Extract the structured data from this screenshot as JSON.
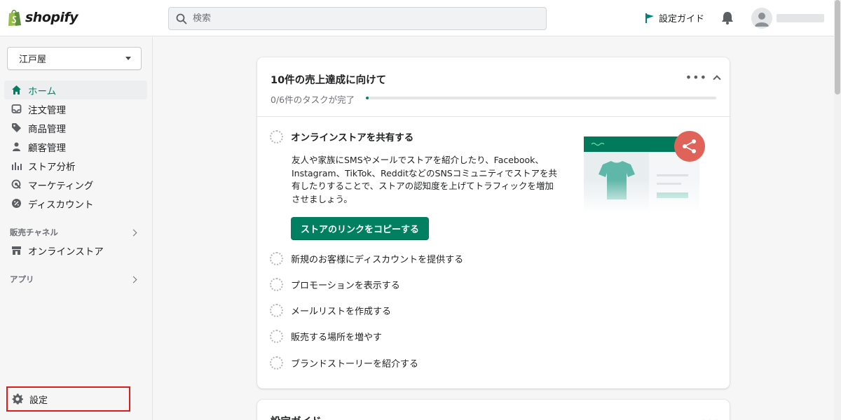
{
  "brand": {
    "name": "shopify",
    "accent": "#008060"
  },
  "search": {
    "placeholder": "検索"
  },
  "header": {
    "setup_guide_label": "設定ガイド"
  },
  "sidebar": {
    "store_name": "江戸屋",
    "items": [
      {
        "label": "ホーム",
        "icon": "home-icon",
        "active": true
      },
      {
        "label": "注文管理",
        "icon": "inbox-icon"
      },
      {
        "label": "商品管理",
        "icon": "tag-icon"
      },
      {
        "label": "顧客管理",
        "icon": "person-icon"
      },
      {
        "label": "ストア分析",
        "icon": "bar-chart-icon"
      },
      {
        "label": "マーケティング",
        "icon": "target-icon"
      },
      {
        "label": "ディスカウント",
        "icon": "discount-icon"
      }
    ],
    "sales_channels_label": "販売チャネル",
    "online_store_label": "オンラインストア",
    "apps_label": "アプリ",
    "settings_label": "設定"
  },
  "card": {
    "title": "10件の売上達成に向けて",
    "progress_text": "0/6件のタスクが完了",
    "progress_fraction": 0,
    "tasks": [
      {
        "label": "オンラインストアを共有する"
      },
      {
        "label": "新規のお客様にディスカウントを提供する"
      },
      {
        "label": "プロモーションを表示する"
      },
      {
        "label": "メールリストを作成する"
      },
      {
        "label": "販売する場所を増やす"
      },
      {
        "label": "ブランドストーリーを紹介する"
      }
    ],
    "open_task_description": "友人や家族にSMSやメールでストアを紹介したり、Facebook、Instagram、TikTok、RedditなどのSNSコミュニティでストアを共有したりすることで、ストアの認知度を上げてトラフィックを増加させましょう。",
    "primary_button_label": "ストアのリンクをコピーする"
  },
  "card2": {
    "title": "設定ガイド"
  },
  "colors": {
    "highlight_border": "#e01b1b",
    "share_badge": "#e0635a",
    "shirt": "#5fb7a9"
  }
}
